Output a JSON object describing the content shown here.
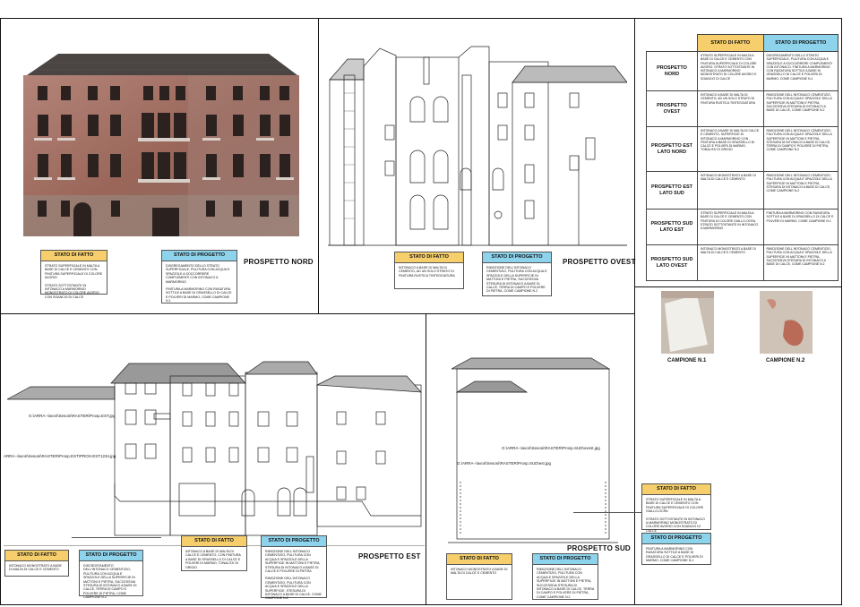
{
  "headers": {
    "fatto": "STATO DI FATTO",
    "progetto": "STATO DI PROGETTO"
  },
  "elevations": {
    "nord": "PROSPETTO NORD",
    "ovest": "PROSPETTO OVEST",
    "est": "PROSPETTO EST",
    "sud": "PROSPETTO SUD"
  },
  "notes": {
    "nord_fatto": [
      "STRATO SUPERFICIALE IN MALTA A BASE DI CALCE E CEMENTO CON FINITURA SUPERFICIALE DI COLORE AVORIO",
      "STRATO SOTTOSTANTE IN INTONACO A MARMORINO MONOSTRATO DI COLORE AVORIO CON SGANCIO DI CALCE"
    ],
    "nord_progetto": [
      "DISGREGAMENTO DELLO STRATO SUPERFICIALE, PULITURA CON ACQUA E SPAZZOLE A SOCCORRERE COMPLEMENTI CON INTONACO A MARMORINO",
      "FINITURA A MARMORINO CON RASATURA SOTTILE A BASE DI GRASSELLO DI CALCE E POLVERI DI MARMO, COME CAMPIONE N.1"
    ],
    "ovest_fatto": [
      "INTONACO A BASE DI MALTA DI CEMENTO, AD UN SOLO STRATO DI FINITURA RUSTICA TINTEGGIATURA"
    ],
    "ovest_progetto": [
      "RIMOZIONE DELL'INTONACO CEMENTIZIO, PULITURA CON ACQUA E SPAZZOLE DELLA SUPERFICIE IN MATTONI E PIETRA, SUCCESSIVA STESURA DI INTONACO A BASE DI CALCE, TERRA DI CAMPO E POLVERE DI PIETRA, COME CAMPIONE N.2"
    ],
    "est_fatto_left": [
      "INTONACO MONOSTRATO A BASE DI MALTA DI CALCE E CEMENTO"
    ],
    "est_progetto_left": [
      "DISCROSTAMENTO DELL'INTONACO CEMENTIZIO, PULITURA CON ACQUA E SPAZZOLE DELLA SUPERFICIE IN MATTONI E PIETRA, SUCCESSIVA STESURA DI INTONACO A BASE DI CALCE, TERRA DI CAMPO E POLVERE DI PIETRA, COME CAMPIONE N.2"
    ],
    "est_fatto_mid": [
      "INTONACO A BASE DI MALTA DI CALCE E CEMENTO, CON FINITURA A BASE DI GRASSELLO DI CALCE E POLVERI DI MARMO, TONALITA' DI GRIGIO"
    ],
    "est_progetto_mid": [
      "RIMOZIONE DELL'INTONACO CEMENTIZIO, PULITURA CON ACQUA E SPAZZOLE DELLA SUPERFICIE IN MATTONI E PIETRA, STESURA DI INTONACO A BASE DI CALCE E POLVERE DI PIETRA",
      "RIMOZIONE DELL'INTONACO CEMENTIZIO, PULITURA CON ACQUA E SPAZZOLE DELLA SUPERFICIE, STESURA DI INTONACO A BASE DI CALCE, COME CAMPIONE N.2"
    ],
    "sud_fatto": [
      "INTONACO MONOSTRATO A BASE DI MALTA DI CALCE E CEMENTO"
    ],
    "sud_progetto": [
      "RIMOZIONE DELL'INTONACO CEMENTIZIO, PULITURA CON ACQUA E SPAZZOLE DELLA SUPERFICIE IN MATTONI E PIETRA, SUCCESSIVA STESURA DI INTONACO A BASE DI CALCE, TERRA DI CAMPO E POLVERE DI PIETRA, COME CAMPIONE N.2"
    ],
    "right_fatto": [
      "STRATO SUPERFICIALE IN MALTA A BASE DI CALCE E CEMENTO CON FINITURA SUPERFICIALE DI COLORE GIALLO-OCRA",
      "STRATO SOTTOSTANTE IN INTONACO A MARMORINO MONOSTRATO DI COLORE AVORIO CON SGANCIO DI CALCE"
    ],
    "right_progetto": [
      "FINITURA A MARMORINO CON RASATURA SOTTILE A BASE DI GRASSELLO DI CALCE E POLVERI DI MARMO, COME CAMPIONE N.1"
    ]
  },
  "table": {
    "rows": [
      {
        "label": "PROSPETTO NORD",
        "fatto": "STRATO SUPERFICIALE IN MALTA A BASE DI CALCE E CEMENTO CON FINITURA SUPERFICIALE DI COLORE AVORIO. STRATO SOTTOSTANTE IN INTONACO A MARMORINO MONOSTRATO DI COLORE AVORIO E SGANCIO DI CALCE",
        "progetto": "DISGREGAMENTO DELLO STRATO SUPERFICIALE, PULITURA CON ACQUA E SPAZZOLE A SOCCORRERE COMPLEMENTI CON INTONACO. FINITURA A MARMORINO CON RASATURA SOTTILE A BASE DI GRASSELLO DI CALCE E POLVERI DI MARMO, COME CAMPIONE N.1"
      },
      {
        "label": "PROSPETTO OVEST",
        "fatto": "INTONACO A BASE DI MALTA DI CEMENTO, AD UN SOLO STRATO DI FINITURA RUSTICA TINTEGGIATURA",
        "progetto": "RIMOZIONE DELL'INTONACO CEMENTIZIO, PULITURA CON ACQUA E SPAZZOLE DELLA SUPERFICIE IN MATTONI E PIETRA, SUCCESSIVA STESURA DI INTONACO A BASE DI CALCE, COME CAMPIONE N.2"
      },
      {
        "label": "PROSPETTO EST LATO NORD",
        "fatto": "INTONACO A BASE DI MALTA DI CALCE E CEMENTO, SUPERFICIE DI INTONACO A MARMORINO CON FINITURA A BASE DI GRASSELLO DI CALCE E POLVERI DI MARMO, TONALITA' DI GRIGIO",
        "progetto": "RIMOZIONE DELL'INTONACO CEMENTIZIO, PULITURA CON ACQUA E SPAZZOLE DELLA SUPERFICIE IN MATTONI E PIETRA, STESURA DI INTONACO A BASE DI CALCE, TERRA DI CAMPO E POLVERE DI PIETRA, COME CAMPIONE N.2"
      },
      {
        "label": "PROSPETTO EST LATO SUD",
        "fatto": "INTONACO MONOSTRATO A BASE DI MALTA DI CALCE E CEMENTO",
        "progetto": "RIMOZIONE DELL'INTONACO CEMENTIZIO, PULITURA CON ACQUA E SPAZZOLE DELLA SUPERFICIE IN MATTONI E PIETRA, STESURA DI INTONACO A BASE DI CALCE, COME CAMPIONE N.2"
      },
      {
        "label": "PROSPETTO SUD LATO EST",
        "fatto": "STRATO SUPERFICIALE IN MALTA A BASE DI CALCE E CEMENTO CON FINITURA DI COLORE GIALLO-OCRA. STRATO SOTTOSTANTE IN INTONACO A MARMORINO",
        "progetto": "FINITURA A MARMORINO CON RASATURA SOTTILE A BASE DI GRASSELLO DI CALCE E POLVERI DI MARMO, COME CAMPIONE N.1"
      },
      {
        "label": "PROSPETTO SUD LATO OVEST",
        "fatto": "INTONACO MONOSTRATO A BASE DI MALTA DI CALCE E CEMENTO",
        "progetto": "RIMOZIONE DELL'INTONACO CEMENTIZIO, PULITURA CON ACQUA E SPAZZOLE DELLA SUPERFICIE IN MATTONI E PIETRA, SUCCESSIVA STESURA DI INTONACO A BASE DI CALCE, COME CAMPIONE N.2"
      }
    ]
  },
  "samples": {
    "one": "CAMPIONE N.1",
    "two": "CAMPIONE N.2"
  },
  "paths": {
    "est_top": "G:\\ARRA--lavori\\Sesoni\\RASTER\\Prosp.EST.jpg",
    "est_side": "ARRA--lavori\\Sesoni\\RASTER\\Prosp.EST\\PROS-EST1234.jpg",
    "sud_a": "G:\\ARRA--lavori\\Sesoni\\RASTER\\Prosp.SUD\\ovest.jpg",
    "sud_b": "G:\\ARRA--lavori\\Sesoni\\RASTER\\Prosp.SUD\\est.jpg"
  },
  "colors": {
    "fatto": "#f6cf6c",
    "progetto": "#8ed3ec",
    "facade": "#9b6a5e"
  }
}
